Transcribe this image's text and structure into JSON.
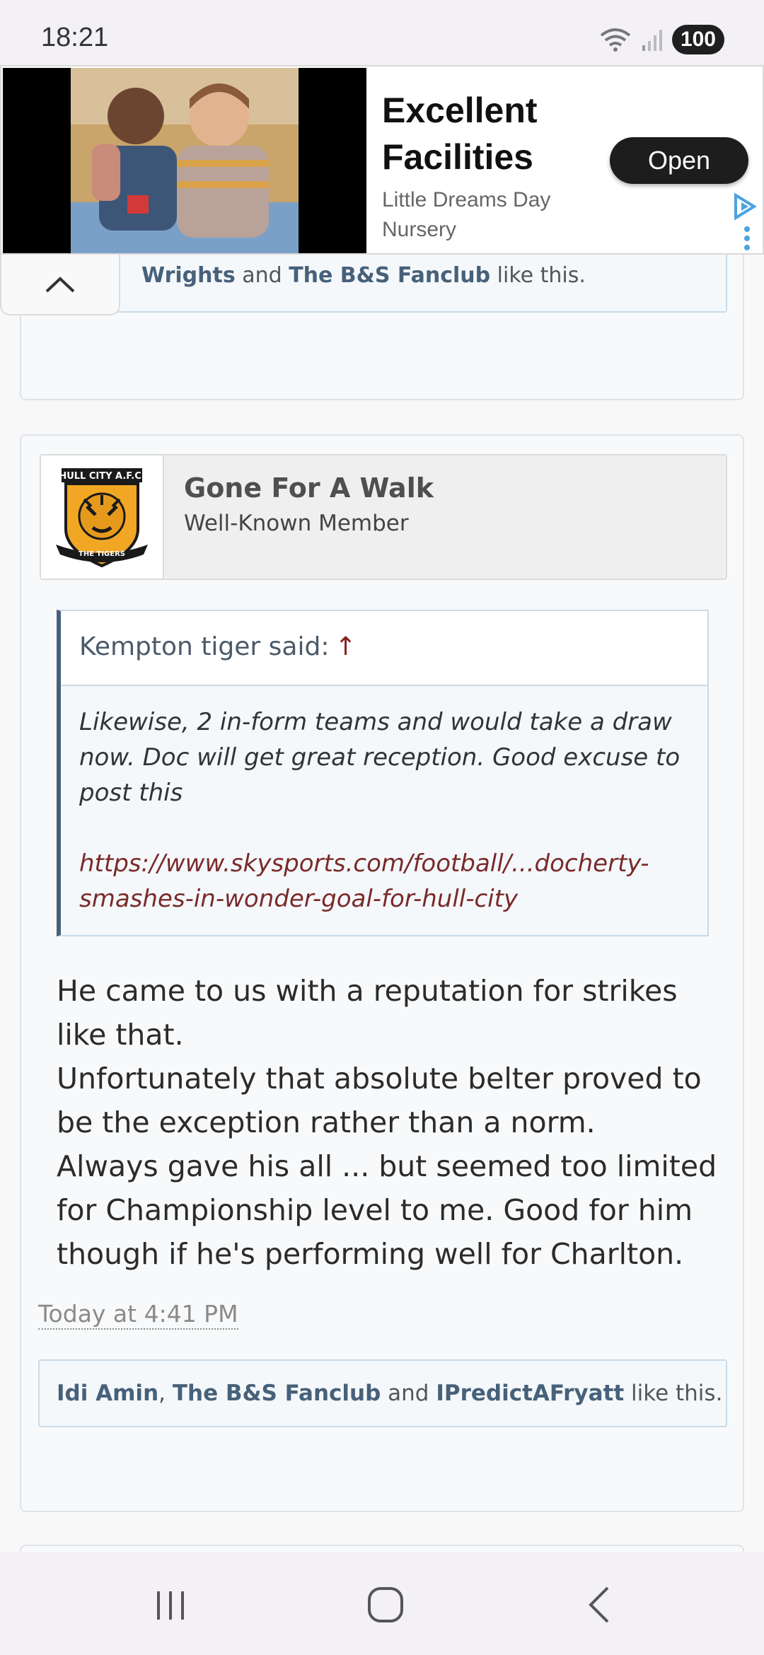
{
  "status_bar": {
    "time": "18:21",
    "battery": "100",
    "icons": [
      "wifi-icon",
      "signal-icon",
      "battery-icon"
    ]
  },
  "ad": {
    "headline_line1": "Excellent",
    "headline_line2": "Facilities",
    "advertiser_line1": "Little Dreams Day",
    "advertiser_line2": "Nursery",
    "open_label": "Open",
    "icons": [
      "adchoices-icon",
      "more-options-icon"
    ]
  },
  "previous_post": {
    "likes": {
      "user1": "Wrights",
      "and": " and ",
      "user2": "The B&S Fanclub",
      "suffix": " like this."
    }
  },
  "post": {
    "author": {
      "name": "Gone For A Walk",
      "title": "Well-Known Member",
      "avatar_label": "HULL CITY A.F.C.",
      "avatar_sub": "THE TIGERS"
    },
    "quote": {
      "attribution": "Kempton tiger said:",
      "arrow": "↑",
      "text": "Likewise, 2 in-form teams and would take a draw now. Doc will get great reception. Good excuse to post this",
      "link": "https://www.skysports.com/football/...docherty-smashes-in-wonder-goal-for-hull-city"
    },
    "message_lines": [
      "He came to us with a reputation for strikes like that.",
      "Unfortunately that absolute belter proved to be the exception rather than a norm.",
      "Always gave his all ... but seemed too limited for Championship level to me. Good for him though if he's performing well for Charlton."
    ],
    "timestamp": "Today at 4:41 PM",
    "likes": {
      "user1": "Idi Amin",
      "sep": ", ",
      "user2": "The B&S Fanclub",
      "and": " and ",
      "user3": "IPredictAFryatt",
      "suffix": " like this."
    }
  },
  "nav_bar": {
    "icons": [
      "recent-apps-icon",
      "home-icon",
      "back-icon"
    ]
  }
}
